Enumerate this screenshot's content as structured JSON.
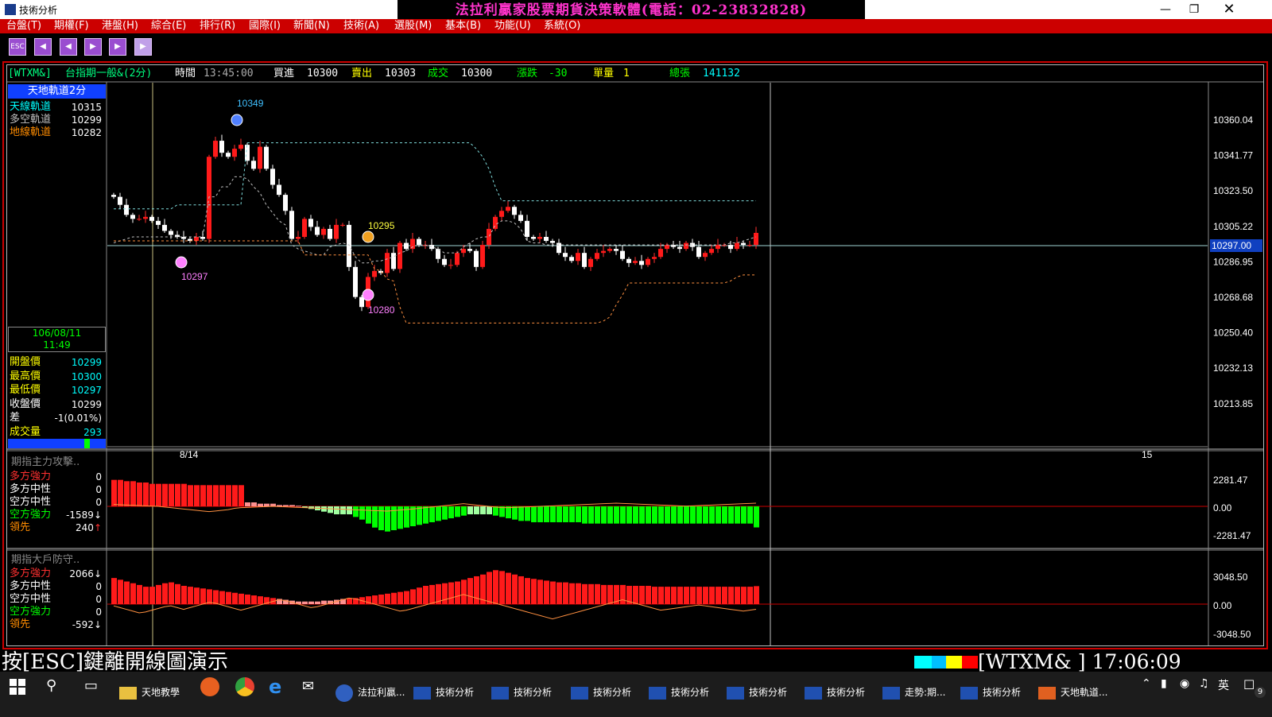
{
  "window": {
    "title": "技術分析",
    "banner": "法拉利贏家股票期貨決策軟體(電話：02-23832828)"
  },
  "menu": [
    "台盤(T)",
    "期權(F)",
    "港盤(H)",
    "綜合(E)",
    "排行(R)",
    "國際(I)",
    "新聞(N)",
    "技術(A)",
    "選股(M)",
    "基本(B)",
    "功能(U)",
    "系統(O)"
  ],
  "toolbar": {
    "esc_label": "ESC"
  },
  "quote": {
    "symbol": "[WTXM&]",
    "name": "台指期一般&(2分)",
    "time_label": "時間",
    "time": "13:45:00",
    "bid_label": "買進",
    "bid": "10300",
    "ask_label": "賣出",
    "ask": "10303",
    "last_label": "成交",
    "last": "10300",
    "change_label": "漲跌",
    "change": "-30",
    "vol_label": "單量",
    "vol": "1",
    "total_label": "總張",
    "total": "141132"
  },
  "indicator": {
    "title": "天地軌道2分",
    "rows": [
      {
        "label": "天線軌道",
        "value": "10315",
        "color": "#00ffff"
      },
      {
        "label": "多空軌道",
        "value": "10299",
        "color": "#c0c0c0"
      },
      {
        "label": "地線軌道",
        "value": "10282",
        "color": "#ff8c00"
      }
    ]
  },
  "cursor_info": {
    "date": "106/08/11",
    "time": "11:49",
    "rows": [
      {
        "label": "開盤價",
        "value": "10299",
        "label_color": "#ffff00",
        "value_color": "#00ffff"
      },
      {
        "label": "最高價",
        "value": "10300",
        "label_color": "#ffff00",
        "value_color": "#00ffff"
      },
      {
        "label": "最低價",
        "value": "10297",
        "label_color": "#ffff00",
        "value_color": "#00ffff"
      },
      {
        "label": "收盤價",
        "value": "10299",
        "label_color": "#ffffff",
        "value_color": "#ffffff"
      },
      {
        "label": "差",
        "value": "-1(0.01%)",
        "label_color": "#ffffff",
        "value_color": "#ffffff"
      },
      {
        "label": "成交量",
        "value": "293",
        "label_color": "#ffff00",
        "value_color": "#00ffff"
      }
    ]
  },
  "chart_data": {
    "type": "candlestick",
    "y_ticks": [
      "10360.04",
      "10341.77",
      "10323.50",
      "10305.22",
      "10286.95",
      "10268.68",
      "10250.40",
      "10232.13",
      "10213.85"
    ],
    "ylim": [
      10200,
      10377
    ],
    "current_price": "10297.00",
    "x_labels": [
      "8/14",
      "15"
    ],
    "markers": [
      {
        "value": "10349",
        "kind": "peak"
      },
      {
        "value": "10295",
        "kind": "mid"
      },
      {
        "value": "10297",
        "kind": "trough"
      },
      {
        "value": "10280",
        "kind": "trough"
      }
    ],
    "candle_closes": [
      10320,
      10316,
      10311,
      10309,
      10309,
      10310,
      10308,
      10306,
      10303,
      10301,
      10300,
      10299,
      10298,
      10300,
      10299,
      10340,
      10348,
      10342,
      10340,
      10344,
      10346,
      10338,
      10334,
      10345,
      10334,
      10326,
      10321,
      10313,
      10299,
      10300,
      10309,
      10305,
      10301,
      10304,
      10299,
      10306,
      10306,
      10285,
      10270,
      10265,
      10280,
      10283,
      10282,
      10292,
      10284,
      10297,
      10294,
      10299,
      10296,
      10296,
      10294,
      10289,
      10286,
      10286,
      10292,
      10294,
      10293,
      10285,
      10296,
      10304,
      10310,
      10313,
      10315,
      10311,
      10308,
      10300,
      10299,
      10300,
      10298,
      10297,
      10292,
      10290,
      10288,
      10292,
      10285,
      10289,
      10292,
      10293,
      10294,
      10293,
      10289,
      10287,
      10288,
      10286,
      10289,
      10290,
      10294,
      10296,
      10295,
      10294,
      10297,
      10295,
      10290,
      10292,
      10294,
      10296,
      10296,
      10294,
      10297,
      10296,
      10296,
      10302
    ],
    "sky_line": [
      10314,
      10314,
      10314,
      10314,
      10314,
      10314,
      10314,
      10314,
      10314,
      10314,
      10316,
      10316,
      10316,
      10316,
      10316,
      10316,
      10316,
      10316,
      10316,
      10316,
      10316,
      10347,
      10347,
      10347,
      10347,
      10347,
      10347,
      10347,
      10347,
      10347,
      10347,
      10347,
      10347,
      10347,
      10347,
      10347,
      10347,
      10347,
      10347,
      10347,
      10347,
      10347,
      10347,
      10347,
      10347,
      10347,
      10347,
      10347,
      10347,
      10347,
      10347,
      10347,
      10347,
      10347,
      10347,
      10347,
      10347,
      10344,
      10340,
      10334,
      10325,
      10318,
      10318,
      10318,
      10318,
      10318,
      10318,
      10318,
      10318,
      10318,
      10318,
      10318,
      10318,
      10318,
      10318,
      10318,
      10318,
      10318,
      10318,
      10318,
      10318,
      10318,
      10318,
      10318,
      10318,
      10318,
      10318,
      10318,
      10318,
      10318,
      10318,
      10318,
      10318,
      10318,
      10318,
      10318,
      10318,
      10318,
      10318,
      10318,
      10318,
      10318
    ],
    "mid_line": [
      10297,
      10298,
      10299,
      10300,
      10300,
      10300,
      10300,
      10300,
      10300,
      10300,
      10300,
      10300,
      10300,
      10300,
      10300,
      10320,
      10320,
      10325,
      10325,
      10330,
      10330,
      10329,
      10325,
      10322,
      10316,
      10312,
      10308,
      10306,
      10296,
      10294,
      10293,
      10292,
      10291,
      10291,
      10295,
      10296,
      10297,
      10296,
      10290,
      10287,
      10287,
      10288,
      10288,
      10289,
      10290,
      10292,
      10293,
      10295,
      10296,
      10296,
      10295,
      10294,
      10292,
      10292,
      10292,
      10295,
      10297,
      10299,
      10300,
      10300,
      10306,
      10308,
      10308,
      10307,
      10304,
      10298,
      10297,
      10297,
      10296,
      10296,
      10296,
      10296,
      10296,
      10296,
      10296,
      10296,
      10296,
      10296,
      10296,
      10296,
      10296,
      10296,
      10296,
      10296,
      10296,
      10296,
      10296,
      10296,
      10296,
      10296,
      10296,
      10296,
      10296,
      10296,
      10296,
      10296,
      10296,
      10297,
      10297,
      10298,
      10299,
      10300
    ],
    "ground_line": [
      10298,
      10298,
      10298,
      10298,
      10298,
      10298,
      10298,
      10298,
      10298,
      10298,
      10298,
      10298,
      10298,
      10298,
      10298,
      10298,
      10298,
      10298,
      10298,
      10298,
      10298,
      10298,
      10298,
      10298,
      10298,
      10298,
      10298,
      10298,
      10298,
      10298,
      10291,
      10291,
      10291,
      10291,
      10291,
      10291,
      10291,
      10291,
      10291,
      10291,
      10291,
      10284,
      10283,
      10279,
      10278,
      10265,
      10257,
      10257,
      10257,
      10257,
      10257,
      10257,
      10257,
      10257,
      10257,
      10257,
      10257,
      10257,
      10257,
      10257,
      10257,
      10257,
      10257,
      10257,
      10257,
      10257,
      10257,
      10257,
      10257,
      10257,
      10257,
      10257,
      10257,
      10257,
      10257,
      10257,
      10257,
      10258,
      10260,
      10266,
      10271,
      10277,
      10277,
      10277,
      10277,
      10277,
      10277,
      10277,
      10277,
      10277,
      10277,
      10277,
      10277,
      10277,
      10277,
      10277,
      10277,
      10278,
      10280,
      10281,
      10281,
      10281
    ]
  },
  "sub1": {
    "title": "期指主力攻擊..",
    "rows": [
      {
        "label": "多方強力",
        "value": "0",
        "color": "#ff3030",
        "arrow": ""
      },
      {
        "label": "多方中性",
        "value": "0",
        "color": "#ffffff",
        "arrow": ""
      },
      {
        "label": "空方中性",
        "value": "0",
        "color": "#ffffff",
        "arrow": ""
      },
      {
        "label": "空方強力",
        "value": "-1589",
        "color": "#00ff00",
        "arrow": "↓"
      },
      {
        "label": "領先",
        "value": "240",
        "color": "#ff8c00",
        "arrow": "↑"
      }
    ],
    "y_ticks": [
      "2281.47",
      "0.00",
      "-2281.47"
    ],
    "ylim": [
      -2700,
      2700
    ],
    "bars": [
      2000,
      2000,
      1900,
      1900,
      1800,
      1800,
      1700,
      1700,
      1700,
      1700,
      1700,
      1700,
      1600,
      1600,
      1600,
      1600,
      1600,
      1600,
      1600,
      1600,
      1600,
      300,
      300,
      200,
      200,
      200,
      100,
      100,
      100,
      50,
      -100,
      -200,
      -300,
      -400,
      -500,
      -600,
      -600,
      -600,
      -800,
      -1000,
      -1300,
      -1600,
      -1800,
      -1900,
      -1800,
      -1700,
      -1600,
      -1500,
      -1400,
      -1300,
      -1200,
      -1100,
      -1000,
      -900,
      -800,
      -700,
      -600,
      -600,
      -600,
      -600,
      -700,
      -800,
      -900,
      -1000,
      -1100,
      -1100,
      -1200,
      -1200,
      -1200,
      -1200,
      -1200,
      -1200,
      -1200,
      -1200,
      -1300,
      -1300,
      -1300,
      -1300,
      -1300,
      -1300,
      -1300,
      -1300,
      -1300,
      -1300,
      -1300,
      -1300,
      -1300,
      -1300,
      -1300,
      -1300,
      -1300,
      -1300,
      -1300,
      -1300,
      -1300,
      -1300,
      -1300,
      -1300,
      -1300,
      -1300,
      -1300,
      -1589
    ],
    "line": [
      150,
      120,
      100,
      80,
      60,
      40,
      20,
      0,
      -50,
      -100,
      -150,
      -200,
      -250,
      -300,
      -350,
      -400,
      -350,
      -300,
      -250,
      -150,
      -100,
      -80,
      -60,
      -40,
      -20,
      0,
      -20,
      -40,
      -60,
      -80,
      -100,
      -120,
      -140,
      -160,
      -180,
      -200,
      -220,
      -240,
      -260,
      -280,
      -300,
      -320,
      -340,
      -360,
      -320,
      -280,
      -240,
      -200,
      -150,
      -100,
      -50,
      0,
      50,
      100,
      150,
      200,
      150,
      100,
      50,
      0,
      -50,
      -100,
      -100,
      -80,
      -60,
      -40,
      -20,
      0,
      20,
      40,
      60,
      80,
      100,
      120,
      140,
      160,
      180,
      200,
      220,
      240,
      220,
      200,
      180,
      160,
      140,
      120,
      100,
      80,
      60,
      40,
      20,
      40,
      60,
      80,
      100,
      120,
      140,
      160,
      180,
      200,
      220,
      240
    ]
  },
  "sub2": {
    "title": "期指大戶防守..",
    "rows": [
      {
        "label": "多方強力",
        "value": "2066",
        "color": "#ff3030",
        "arrow": "↓"
      },
      {
        "label": "多方中性",
        "value": "0",
        "color": "#ffffff",
        "arrow": ""
      },
      {
        "label": "空方中性",
        "value": "0",
        "color": "#ffffff",
        "arrow": ""
      },
      {
        "label": "空方強力",
        "value": "0",
        "color": "#00ff00",
        "arrow": ""
      },
      {
        "label": "領先",
        "value": "-592",
        "color": "#ff8c00",
        "arrow": "↓"
      }
    ],
    "y_ticks": [
      "3048.50",
      "0.00",
      "-3048.50"
    ],
    "ylim": [
      -4200,
      4200
    ],
    "bars": [
      3000,
      2800,
      2600,
      2400,
      2200,
      2000,
      2000,
      2200,
      2400,
      2500,
      2300,
      2100,
      2000,
      1900,
      1800,
      1700,
      1600,
      1500,
      1400,
      1300,
      1200,
      1100,
      1000,
      900,
      800,
      700,
      600,
      500,
      400,
      300,
      300,
      300,
      300,
      400,
      400,
      500,
      600,
      700,
      700,
      800,
      900,
      1000,
      1100,
      1200,
      1300,
      1400,
      1500,
      1700,
      1900,
      2100,
      2200,
      2300,
      2400,
      2500,
      2600,
      2800,
      3000,
      3200,
      3400,
      3700,
      3900,
      3800,
      3600,
      3400,
      3200,
      3000,
      2900,
      2800,
      2700,
      2600,
      2500,
      2500,
      2400,
      2400,
      2300,
      2300,
      2300,
      2200,
      2200,
      2200,
      2200,
      2100,
      2100,
      2100,
      2100,
      2000,
      2000,
      2000,
      2000,
      2000,
      2000,
      2000,
      2000,
      2000,
      2000,
      2000,
      2000,
      2000,
      2000,
      2000,
      2000,
      2066
    ],
    "line": [
      -200,
      -400,
      -600,
      -800,
      -1000,
      -900,
      -700,
      -500,
      -300,
      -200,
      -400,
      -600,
      -400,
      -200,
      0,
      200,
      100,
      -100,
      -300,
      -500,
      -700,
      -500,
      -300,
      -100,
      100,
      300,
      500,
      400,
      200,
      0,
      -200,
      -400,
      -300,
      -100,
      100,
      300,
      500,
      700,
      600,
      400,
      200,
      0,
      -200,
      -400,
      -600,
      -800,
      -700,
      -500,
      -300,
      -100,
      100,
      300,
      500,
      700,
      900,
      1100,
      900,
      700,
      500,
      300,
      100,
      -100,
      -300,
      -500,
      -700,
      -900,
      -1100,
      -1300,
      -1500,
      -1700,
      -1500,
      -1300,
      -1100,
      -900,
      -700,
      -500,
      -300,
      -100,
      100,
      300,
      500,
      300,
      100,
      -100,
      -300,
      -500,
      -700,
      -600,
      -500,
      -400,
      -300,
      -200,
      -100,
      -200,
      -300,
      -400,
      -500,
      -600,
      -700,
      -800,
      -700,
      -592
    ]
  },
  "status": {
    "esc_hint": "按[ESC]鍵離開線圖演示",
    "symbol": "[WTXM&  ]",
    "clock": "17:06:09"
  },
  "taskbar": {
    "items": [
      "天地教學",
      "法拉利贏...",
      "技術分析",
      "技術分析",
      "技術分析",
      "技術分析",
      "技術分析",
      "技術分析",
      "走勢:期...",
      "技術分析",
      "天地軌道..."
    ],
    "ime": "英",
    "notif_count": "9"
  }
}
